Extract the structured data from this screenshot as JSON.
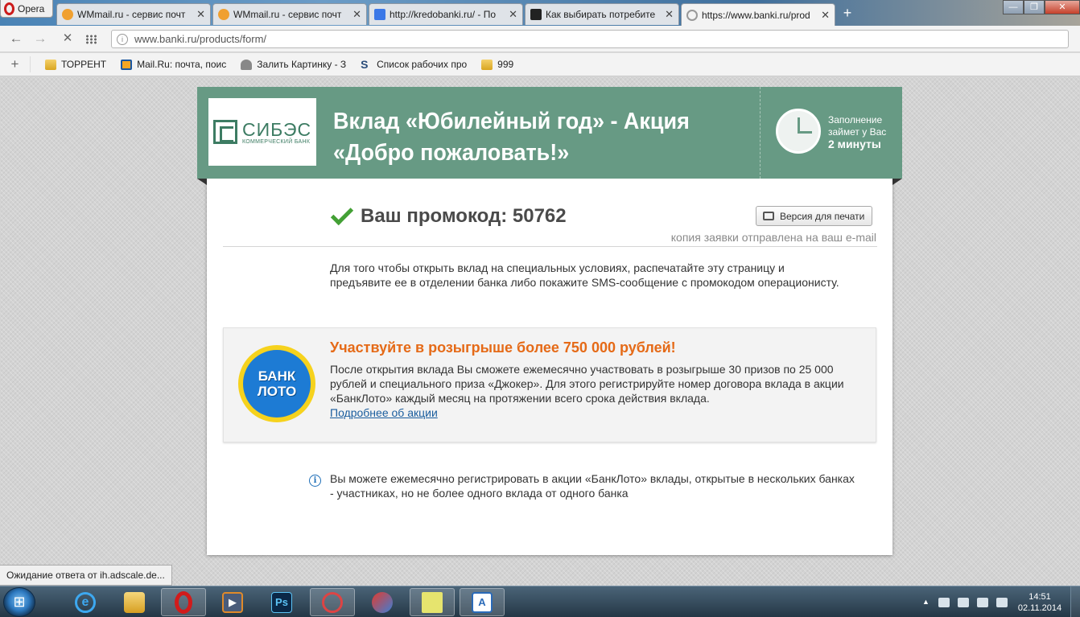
{
  "browser": {
    "menu_label": "Opera",
    "tabs": [
      {
        "title": "WMmail.ru - сервис почт",
        "active": false
      },
      {
        "title": "WMmail.ru - сервис почт",
        "active": false
      },
      {
        "title": "http://kredobanki.ru/ - По",
        "active": false
      },
      {
        "title": "Как выбирать потребите",
        "active": false
      },
      {
        "title": "https://www.banki.ru/prod",
        "active": true
      }
    ],
    "address": "www.banki.ru/products/form/",
    "bookmarks": [
      "ТОРРЕНТ",
      "Mail.Ru: почта, поис",
      "Залить Картинку - З",
      "Список рабочих про",
      "999"
    ],
    "status_text": "Ожидание ответа от ih.adscale.de..."
  },
  "banner": {
    "logo_name": "СИБЭС",
    "logo_sub": "КОММЕРЧЕСКИЙ БАНК",
    "title": "Вклад «Юбилейный год» - Акция «Добро пожаловать!»",
    "fill_line1": "Заполнение",
    "fill_line2": "займет у Вас",
    "fill_time": "2 минуты"
  },
  "content": {
    "promo_label": "Ваш промокод: 50762",
    "print_button": "Версия для печати",
    "copy_note": "копия заявки отправлена на ваш e-mail",
    "intro": "Для того чтобы открыть вклад на специальных условиях, распечатайте эту страницу и предъявите ее в отделении банка либо покажите SMS-сообщение с промокодом операционисту.",
    "loto": {
      "logo_line1": "БАНК",
      "logo_line2": "ЛОТО",
      "title": "Участвуйте в розыгрыше более 750 000 рублей!",
      "text": "После открытия вклада Вы сможете ежемесячно участвовать в розыгрыше 30 призов по 25 000 рублей и специального приза «Джокер». Для этого регистрируйте номер договора вклада в акции «БанкЛото» каждый месяц на протяжении всего срока действия вклада.",
      "link": "Подробнее об акции"
    },
    "info_text": "Вы можете ежемесячно регистрировать в акции «БанкЛото» вклады, открытые в нескольких банках - участниках, но не более одного вклада от одного банка"
  },
  "taskbar": {
    "time": "14:51",
    "date": "02.11.2014"
  },
  "colors": {
    "banner_green": "#679a84",
    "accent_orange": "#e56a17",
    "link_blue": "#1a5d9e"
  }
}
